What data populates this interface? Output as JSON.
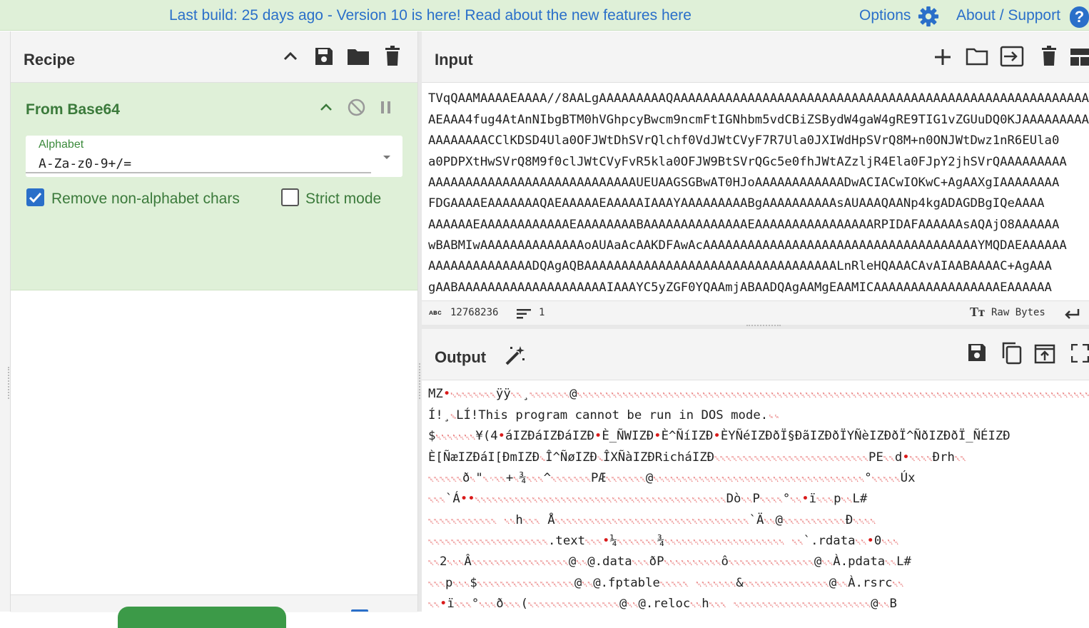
{
  "banner": {
    "notice": "Last build: 25 days ago - Version 10 is here! Read about the new features here",
    "options": "Options",
    "about": "About / Support",
    "help": "?"
  },
  "recipe": {
    "title": "Recipe",
    "icons": [
      "chevron-up-icon",
      "save-icon",
      "folder-icon",
      "trash-icon"
    ],
    "operation": {
      "name": "From Base64",
      "alphabet_label": "Alphabet",
      "alphabet_value": "A-Za-z0-9+/=",
      "remove_nonalpha_label": "Remove non-alphabet chars",
      "remove_nonalpha_checked": true,
      "strict_label": "Strict mode",
      "strict_checked": false
    }
  },
  "input": {
    "title": "Input",
    "lines": [
      "TVqQAAMAAAAEAAAA//8AALgAAAAAAAAAQAAAAAAAAAAAAAAAAAAAAAAAAAAAAAAAAAAAAAAAAAAAAAAAAAAAAAAAAAAAAAAAAAAA",
      "AEAAA4fug4AtAnNIbgBTM0hVGhpcyBwcm9ncmFtIGNhbm5vdCBiZSBydW4gaW4gRE9TIG1vZGUuDQ0KJAAAAAAAAAA",
      "AAAAAAAACClKDSD4Ula0OFJWtDhSVrQlchf0VdJWtCVyF7R7Ula0JXIWdHpSVrQ8M+n0ONJWtDwz1nR6EUla0",
      "a0PDPXtHwSVrQ8M9f0clJWtCVyFvR5kla0OFJW9BtSVrQGc5e0fhJWtAZzljR4Ela0FJpY2jhSVrQAAAAAAAAA",
      "AAAAAAAAAAAAAAAAAAAAAAAAAAAAUEUAAGSGBwAT0HJoAAAAAAAAAAAADwACIACwIOKwC+AgAAXgIAAAAAAAA",
      "FDGAAAAEAAAAAAAQAEAAAAAEAAAAAIAAAYAAAAAAAAABgAAAAAAAAAAsAUAAAQAANp4kgADAGDBgIQeAAAA",
      "AAAAAAEAAAAAAAAAAAAEAAAAAAAABAAAAAAAAAAAAAAEAAAAAAAAAAAAAAAARPIDAFAAAAAAsAQAjO8AAAAAA",
      "wBABMIwAAAAAAAAAAAAAAoAUAaAcAAKDFAwAcAAAAAAAAAAAAAAAAAAAAAAAAAAAAAAAAAAAAAYMQDAEAAAAAA",
      "AAAAAAAAAAAAAADQAgAQBAAAAAAAAAAAAAAAAAAAAAAAAAAAAAAAAAALnRleHQAAACAvAIAABAAAAC+AgAAA",
      "gAABAAAAAAAAAAAAAAAAAAAAIAAAYC5yZGF0YQAAmjABAADQAgAAMgEAAMICAAAAAAAAAAAAAAAAAEAAAAAA"
    ],
    "length": "12768236",
    "lines_count": "1",
    "encoding": "Raw Bytes"
  },
  "output": {
    "title": "Output",
    "lines": [
      "MZ•␃␄␀␀␀␄␀␀ÿÿ␀␀¸␀␀␀␀␀␀␀@␀␀␀␀␀␀␀␀␀␀␀␀␀␀␀␀␀␀␀␀␀␀␀␀␀␀␀␀␀␀␀␀␀␀␀␀␀␀␀␀␀␀␀␀␀␀␀␀␀␀␀␀␀␀␀␀␀␀␀␀␀␀␀␀␀␀␀␀␀␀␀␀␀␀␀␀␀␀␀␀␀␀␀␀␀␀␀␀␀␀␀␀␀␀␀␀␀␀␀␀␀␀␀␀␀␀␀␀␀␀␀␀␀␀␀␀␀␀␀␀␀␀␀␀␀␀",
      "Í!¸␁LÍ!This program cannot be run in DOS mode.␍␍",
      "$␀␀␀␀␀␀␀¥(4•áIZÐáIZÐáIZÐ•È_ÑWIZÐ•È^ÑíIZÐ•ÈYÑéIZÐðÏ§ÐãIZÐðÏYÑèIZÐðÏ^ÑðIZÐðÏ_ÑÉIZÐ",
      "È[ÑæIZÐáI[ÐmIZÐ␘Î^ÑøIZÐ␘ÎXÑàIZÐRicháIZÐ␀␀␀␀␀␀␀␀␀␀␀␀␀␀␀␀␀␀␀␀␀␀␀␀␀␀␀PE␀␀d•␀␀␀␀Ðrh␀␀",
      "␀␀␀␀␀␀ð␀\"␀␋␀␀+␀¾␀␀␀^␀␀␀␀␀␀␀PÆ␀␀␀␀␀␀␀@␀␀␀␀␀␀␀␀␀␀␀␀␀␀␀␀␀␀␀␀␀␀␀␀␀␀␀␀␀␀␀␀␀␀␀␀␀°␀␀␀␀␀Úx",
      "␀␀␀`Á••␀␀␀␀␀␀␀␀␀␀␀␀␀␀␀␀␀␀␀␀␀␀␀␀␀␀␀␀␀␀␀␀␀␀␀␀␀␀␀␀␀␀␀␀Dò␀␀P␀␀␀␀°␀␀•ï␀␀␀p␀␀L#",
      "␀␀␀␀␀␀␀␀␀␀␀␀ ␀␀h␀␀␀ Å␀␀␀␀␀␀␀␀␀␀␀␀␀␀␀␀␀␀␀␀␀␀␀␀␀␀␀␀␀␀␀␀␀␀`Ä␀␀@␀␀␀␀␀␀␀␀␀␀␀Ð␀␀␀␀",
      "␀␀␀␀␀␀␀␀␀␀␀␀␀␀␀␀␀␀␀␀␀.text␀␀␀•¼␀␀␀␀␀␀␀¾␀␀␀␀␀␀␀␀␀␀␀␀␀␀␀␀␀␀␀␀␀ ␀␀`.rdata␀␀•0␀␀␀",
      "␀␀2␀␀␀Â␀␀␀␀␀␀␀␀␀␀␀␀␀␀␀␀␀@␀␀@.data␀␀␀ðP␀␀␀␀␀␀␀␀␀␀ô␀␀␀␀␀␀␀␀␀␀␀␀␀␀␀@␀␀À.pdata␀␀L#",
      "␀␀␀p␀␀␀$␀␀␀␀␀␀␀␀␀␀␀␀␀␀␀␀␀@␀␀@.fptable␀␀␀␀␀ ␀␀␀␀␀␀␀&␀␀␀␀␀␀␀␀␀␀␀␀␀␀␀@␀␀À.rsrc␀␀",
      "␀␀•ï␀␀␀°␀␀␀ð␀␀␀(␀␀␀␀␀␀␀␀␀␀␀␀␀␀␀␀@␀␀@.reloc␀␀h␀␀␀ ␀␀␀␀␀␀␀␀␀␀␀␀␀␀␀␀␀␀␀␀␀␀␀␀@␀␀B"
    ]
  },
  "colors": {
    "accent": "#2a6fc9",
    "op_bg": "#dff0d8",
    "op_text": "#3b7a3b",
    "bake": "#3c9a48"
  }
}
